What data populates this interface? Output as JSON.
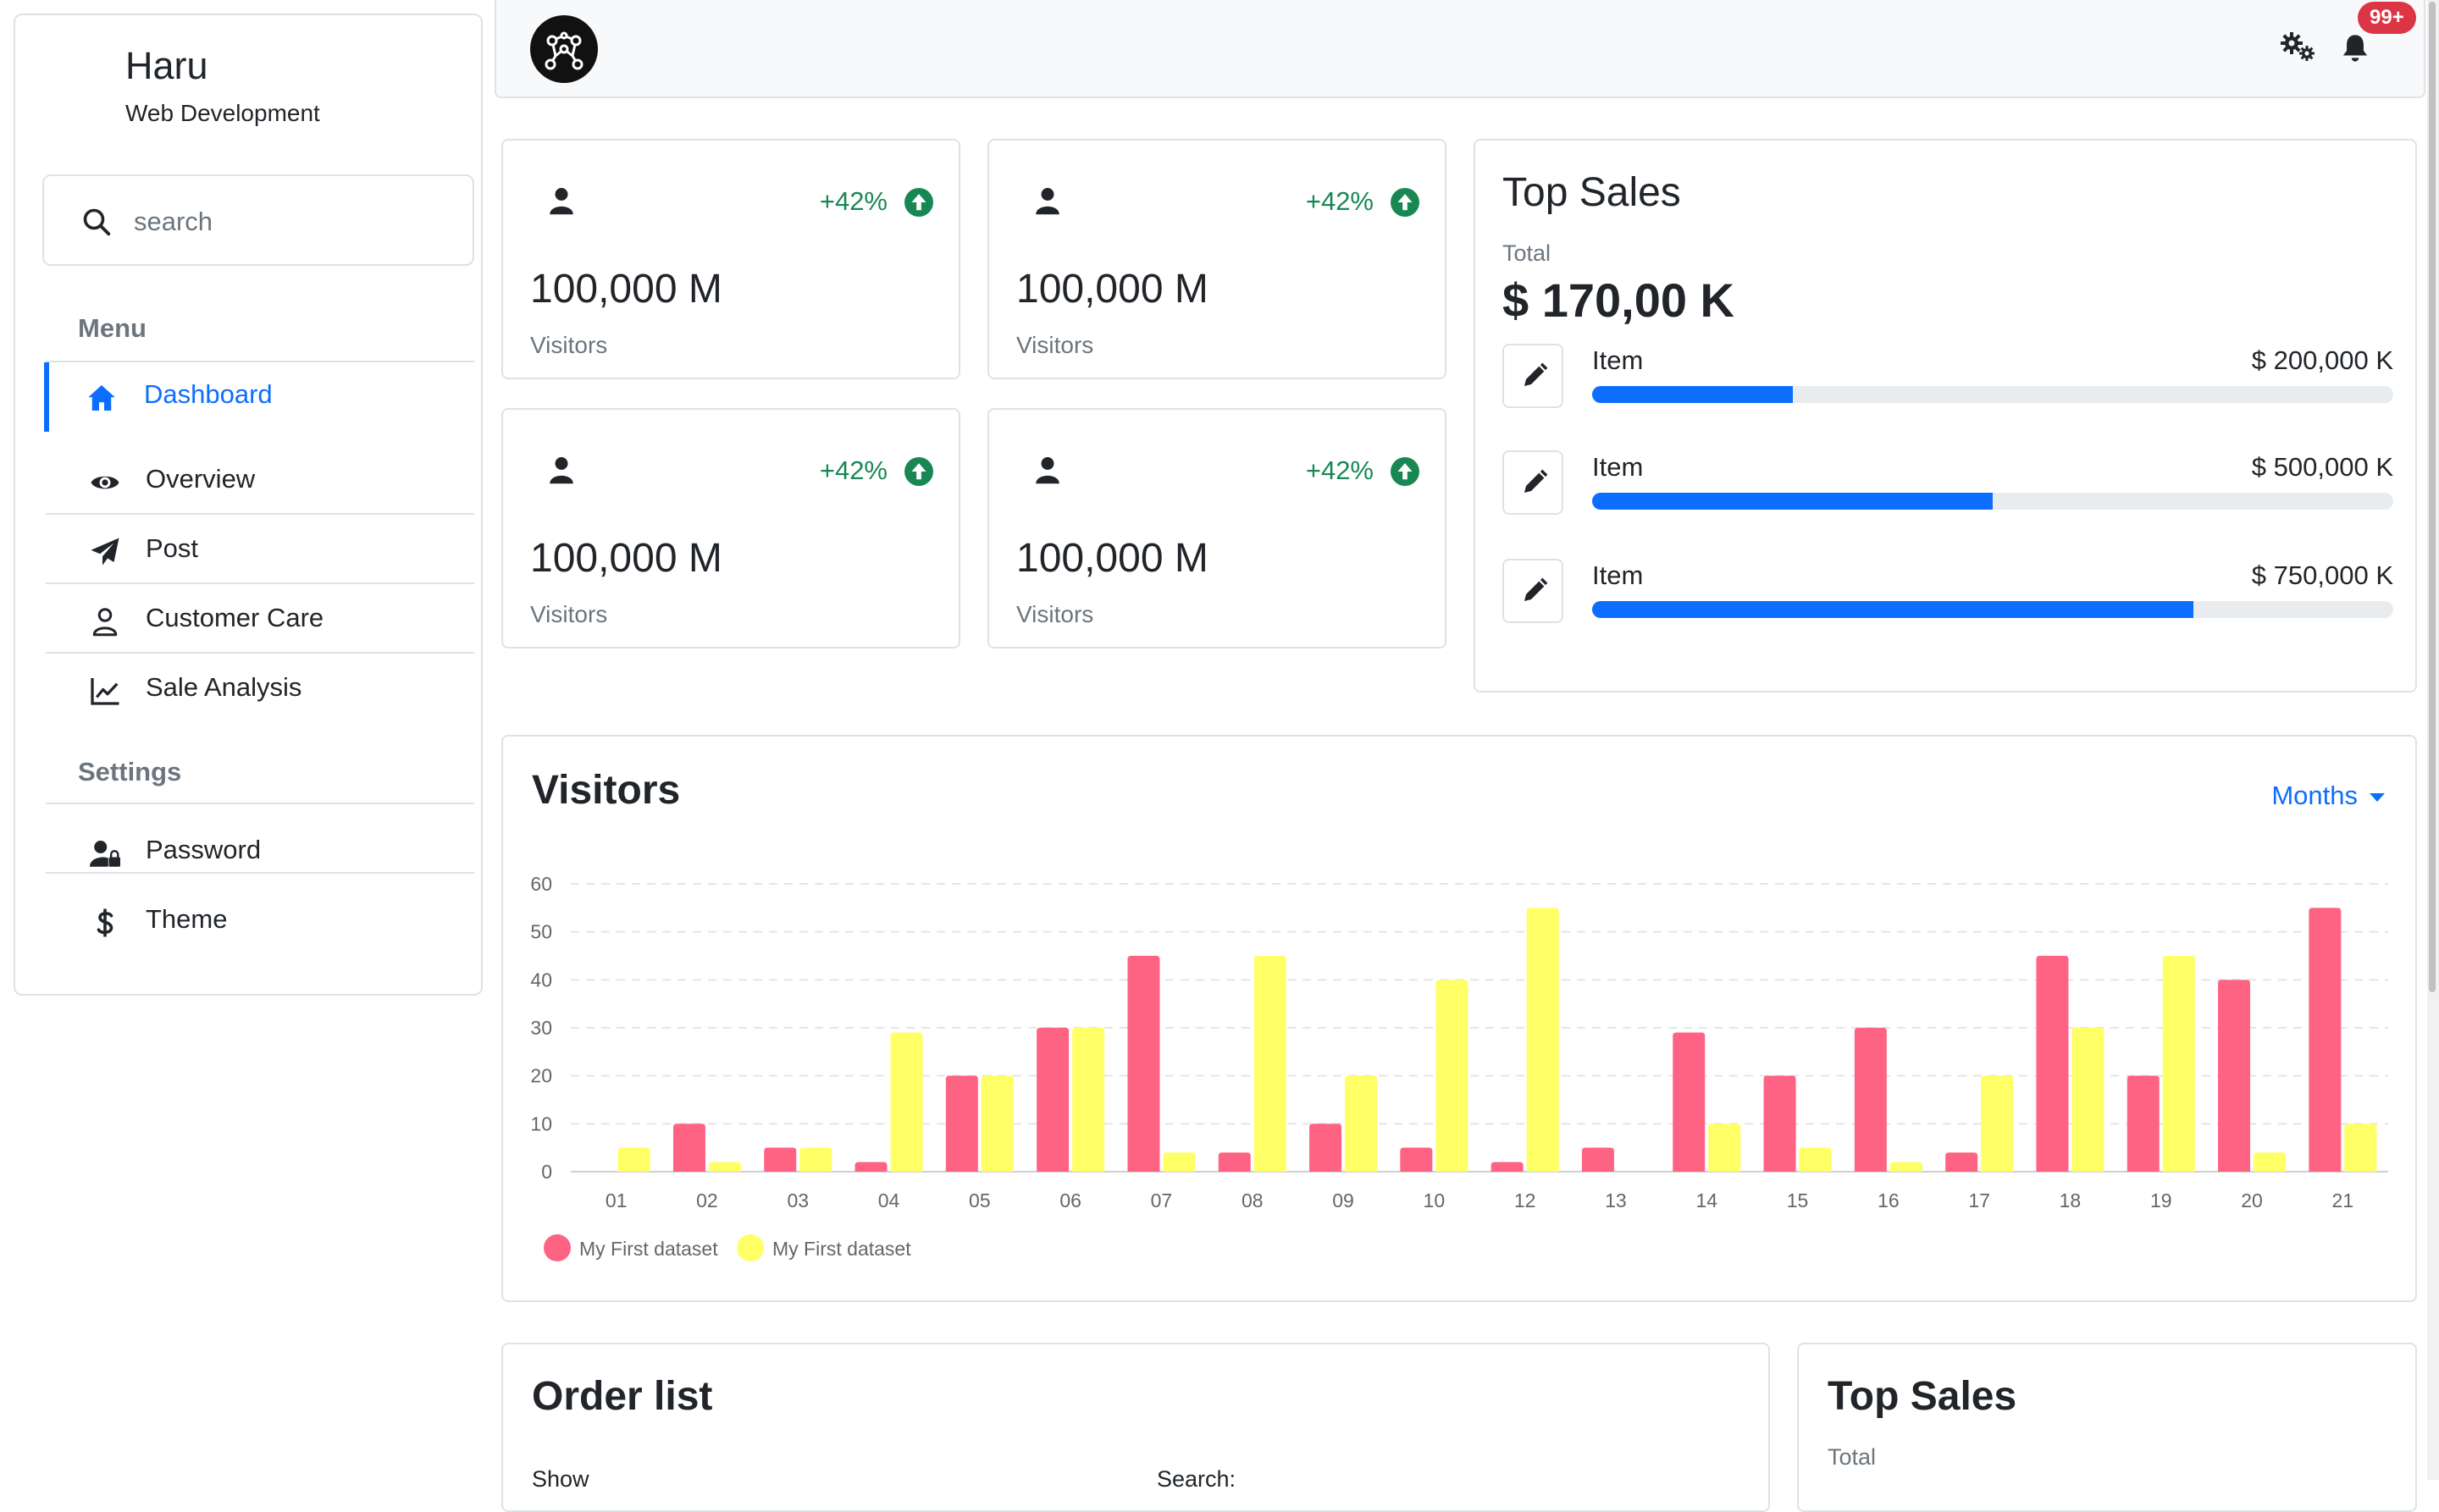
{
  "sidebar": {
    "brand_name": "Haru",
    "brand_sub": "Web Development",
    "search_placeholder": "search",
    "menu_heading": "Menu",
    "settings_heading": "Settings",
    "menu_items": [
      {
        "label": "Dashboard",
        "icon": "home-icon",
        "active": true
      },
      {
        "label": "Overview",
        "icon": "eye-icon"
      },
      {
        "label": "Post",
        "icon": "paper-plane-icon"
      },
      {
        "label": "Customer Care",
        "icon": "user-icon"
      },
      {
        "label": "Sale Analysis",
        "icon": "chart-line-icon"
      }
    ],
    "settings_items": [
      {
        "label": "Password",
        "icon": "user-lock-icon"
      },
      {
        "label": "Theme",
        "icon": "dollar-icon"
      }
    ]
  },
  "topbar": {
    "logo_icon": "network-logo-icon",
    "notification_count": "99+",
    "icons": [
      "gears-icon",
      "bell-icon"
    ]
  },
  "stats": [
    {
      "value": "100,000 M",
      "label": "Visitors",
      "delta": "+42%"
    },
    {
      "value": "100,000 M",
      "label": "Visitors",
      "delta": "+42%"
    },
    {
      "value": "100,000 M",
      "label": "Visitors",
      "delta": "+42%"
    },
    {
      "value": "100,000 M",
      "label": "Visitors",
      "delta": "+42%"
    }
  ],
  "top_sales": {
    "title": "Top Sales",
    "total_label": "Total",
    "total_value": "$ 170,00 K",
    "items": [
      {
        "name": "Item",
        "amount": "$ 200,000 K",
        "progress": 0.25
      },
      {
        "name": "Item",
        "amount": "$ 500,000 K",
        "progress": 0.5
      },
      {
        "name": "Item",
        "amount": "$ 750,000 K",
        "progress": 0.75
      }
    ]
  },
  "visitors": {
    "title": "Visitors",
    "period": "Months"
  },
  "chart_data": {
    "type": "bar",
    "categories": [
      "01",
      "02",
      "03",
      "04",
      "05",
      "06",
      "07",
      "08",
      "09",
      "10",
      "12",
      "13",
      "14",
      "15",
      "16",
      "17",
      "18",
      "19",
      "20",
      "21"
    ],
    "series": [
      {
        "name": "My First dataset",
        "color": "#ff6384",
        "values": [
          0,
          10,
          5,
          2,
          20,
          30,
          45,
          4,
          10,
          5,
          2,
          5,
          29,
          20,
          30,
          4,
          45,
          20,
          40,
          55
        ]
      },
      {
        "name": "My First dataset",
        "color": "#ffff66",
        "values": [
          5,
          2,
          5,
          29,
          20,
          30,
          4,
          45,
          20,
          40,
          55,
          0,
          10,
          5,
          2,
          20,
          30,
          45,
          4,
          10
        ]
      }
    ],
    "ylim": [
      0,
      60
    ],
    "yticks": [
      0,
      10,
      20,
      30,
      40,
      50,
      60
    ],
    "grid": true,
    "legend": "bottom-left"
  },
  "order_list": {
    "title": "Order list",
    "show_label": "Show",
    "search_label": "Search:"
  },
  "top_sales_2": {
    "title": "Top Sales",
    "total_label": "Total"
  }
}
